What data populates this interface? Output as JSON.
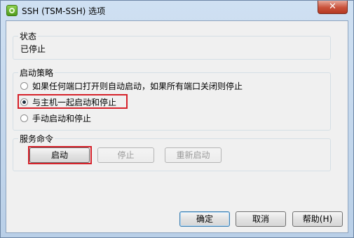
{
  "window": {
    "title": "SSH (TSM-SSH) 选项",
    "close_label": "✕"
  },
  "status_group": {
    "legend": "状态",
    "value": "已停止"
  },
  "policy_group": {
    "legend": "启动策略",
    "options": [
      {
        "label": "如果任何端口打开则自动启动，如果所有端口关闭则停止",
        "checked": false
      },
      {
        "label": "与主机一起启动和停止",
        "checked": true
      },
      {
        "label": "手动启动和停止",
        "checked": false
      }
    ]
  },
  "service_group": {
    "legend": "服务命令",
    "start_label": "启动",
    "stop_label": "停止",
    "restart_label": "重新启动"
  },
  "footer": {
    "ok_label": "确定",
    "cancel_label": "取消",
    "help_label": "帮助(H)"
  },
  "colors": {
    "highlight": "#d6212a",
    "dialog_bg": "#f0f0f0"
  }
}
